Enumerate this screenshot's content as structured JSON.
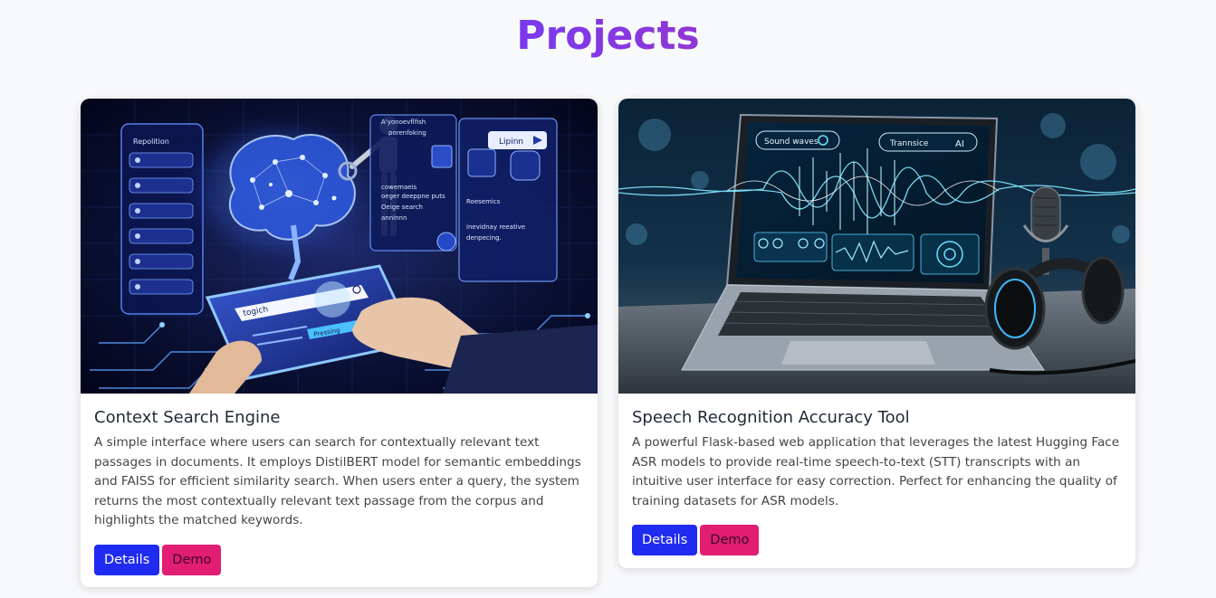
{
  "page": {
    "title": "Projects"
  },
  "colors": {
    "title_gradient_start": "#6d28d9",
    "title_gradient_end": "#db2777",
    "details_button": "#1f2bf0",
    "demo_button": "#e11d74",
    "background": "#f8f9fb"
  },
  "projects": [
    {
      "title": "Context Search Engine",
      "description": "A simple interface where users can search for contextually relevant text passages in documents. It employs DistilBERT model for semantic embeddings and FAISS for efficient similarity search. When users enter a query, the system returns the most contextually relevant text passage from the corpus and highlights the matched keywords.",
      "details_label": "Details",
      "demo_label": "Demo",
      "image": "ai-brain-search-illustration",
      "image_text": {
        "panel_left": "Repolition",
        "panel_top_1": "A'yonoevflfish",
        "panel_top_2": "porenfoking",
        "panel_right": "Lipinn",
        "mid_1": "cowemaeis",
        "mid_2": "oeger deeppne puts",
        "mid_3": "Oeige search",
        "mid_4": "anninnn",
        "right_1": "Roesemics",
        "right_2": "inevidnay reeative",
        "right_3": "denpecing.",
        "search": "togich",
        "button": "Pressing"
      }
    },
    {
      "title": "Speech Recognition Accuracy Tool",
      "description": "A powerful Flask-based web application that leverages the latest Hugging Face ASR models to provide real-time speech-to-text (STT) transcripts with an intuitive user interface for easy correction. Perfect for enhancing the quality of training datasets for ASR models.",
      "details_label": "Details",
      "demo_label": "Demo",
      "image": "laptop-soundwave-illustration",
      "image_text": {
        "pill_1": "Sound waves",
        "pill_2": "Trannsice",
        "pill_2_badge": "AI"
      }
    }
  ]
}
